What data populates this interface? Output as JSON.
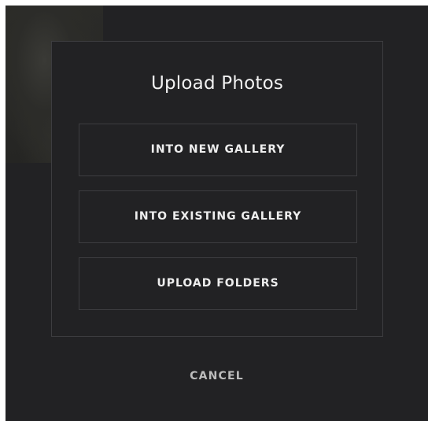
{
  "dialog": {
    "title": "Upload Photos",
    "options": [
      {
        "label": "INTO NEW GALLERY"
      },
      {
        "label": "INTO EXISTING GALLERY"
      },
      {
        "label": "UPLOAD FOLDERS"
      }
    ],
    "cancel_label": "CANCEL"
  },
  "colors": {
    "backdrop": "#222224",
    "border": "#3d3d40",
    "text": "#eeeeee",
    "muted_text": "#bcbcbc"
  }
}
